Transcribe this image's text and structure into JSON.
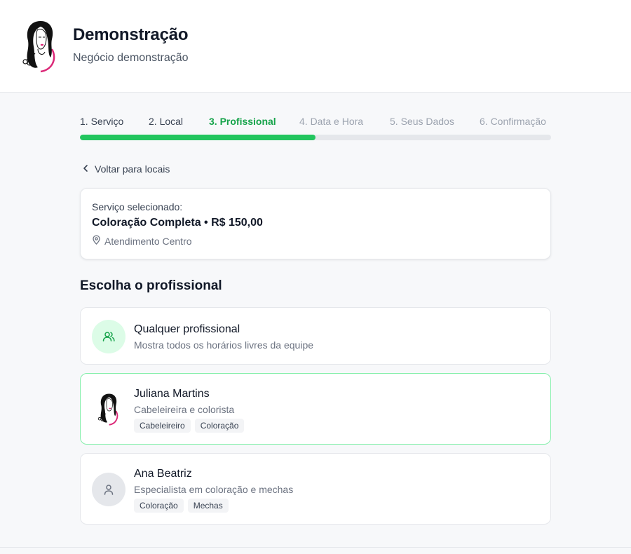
{
  "header": {
    "business_name": "Demonstração",
    "business_subtitle": "Negócio demonstração",
    "logo_icon": "woman-hair-scissors-logo"
  },
  "steps": [
    {
      "label": "1. Serviço",
      "state": "done"
    },
    {
      "label": "2. Local",
      "state": "done"
    },
    {
      "label": "3. Profissional",
      "state": "active"
    },
    {
      "label": "4. Data e Hora",
      "state": "pending"
    },
    {
      "label": "5. Seus Dados",
      "state": "pending"
    },
    {
      "label": "6. Confirmação",
      "state": "pending"
    }
  ],
  "progress": {
    "fraction": 0.5
  },
  "back_link": {
    "label": "Voltar para locais",
    "icon": "chevron-left-icon"
  },
  "summary": {
    "label": "Serviço selecionado:",
    "service": "Coloração Completa • R$ 150,00",
    "location": "Atendimento Centro",
    "location_icon": "map-pin-icon"
  },
  "section_title": "Escolha o profissional",
  "professionals": [
    {
      "name": "Qualquer profissional",
      "description": "Mostra todos os horários livres da equipe",
      "icon": "users-icon",
      "tags": []
    },
    {
      "name": "Juliana Martins",
      "description": "Cabeleireira e colorista",
      "icon": "woman-hair-scissors-logo",
      "tags": [
        "Cabeleireiro",
        "Coloração"
      ]
    },
    {
      "name": "Ana Beatriz",
      "description": "Especialista em coloração e mechas",
      "icon": "user-icon",
      "tags": [
        "Coloração",
        "Mechas"
      ]
    }
  ],
  "colors": {
    "accent": "#22c55e",
    "accent_text": "#16a34a",
    "accent_soft": "#dcfce7",
    "selected_border": "#86efac"
  }
}
